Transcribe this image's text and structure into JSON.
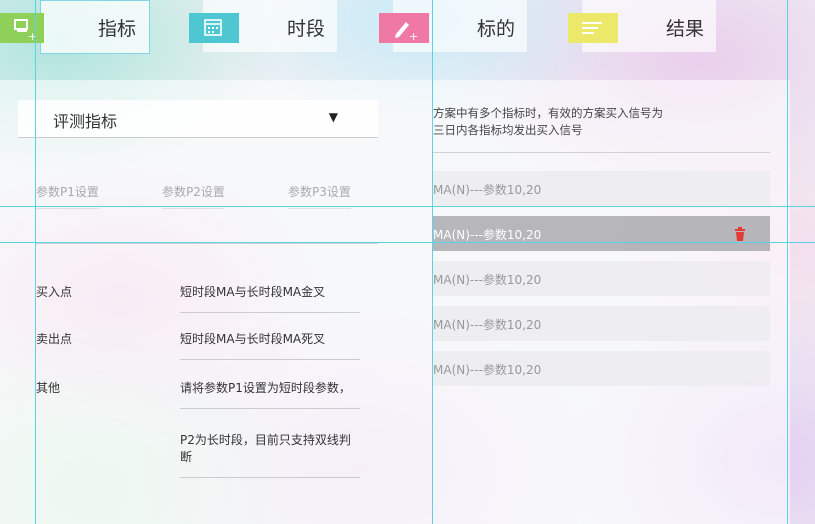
{
  "tabs": [
    {
      "label": "指标",
      "icon": "chart-add-icon",
      "color": "#8fd05a"
    },
    {
      "label": "时段",
      "icon": "calendar-icon",
      "color": "#4ec7d3"
    },
    {
      "label": "标的",
      "icon": "pen-add-icon",
      "color": "#ef78a5"
    },
    {
      "label": "结果",
      "icon": "list-icon",
      "color": "#ece869"
    }
  ],
  "left": {
    "dropdown": {
      "label": "评测指标",
      "arrow": "▼"
    },
    "params": [
      "参数P1设置",
      "参数P2设置",
      "参数P3设置"
    ],
    "rows": [
      {
        "label": "买入点",
        "value": "短时段MA与长时段MA金叉"
      },
      {
        "label": "卖出点",
        "value": "短时段MA与长时段MA死叉"
      },
      {
        "label": "其他",
        "value": "请将参数P1设置为短时段参数，"
      },
      {
        "label": "",
        "value": "P2为长时段，目前只支持双线判断"
      }
    ]
  },
  "right": {
    "note_line1": "方案中有多个指标时，有效的方案买入信号为",
    "note_line2": "三日内各指标均发出买入信号",
    "items": [
      "MA(N)---参数10,20",
      "MA(N)---参数10,20",
      "MA(N)---参数10,20",
      "MA(N)---参数10,20",
      "MA(N)---参数10,20"
    ],
    "selected_index": 1,
    "delete_color": "#e53935"
  },
  "guide_color": "#59d3e6"
}
